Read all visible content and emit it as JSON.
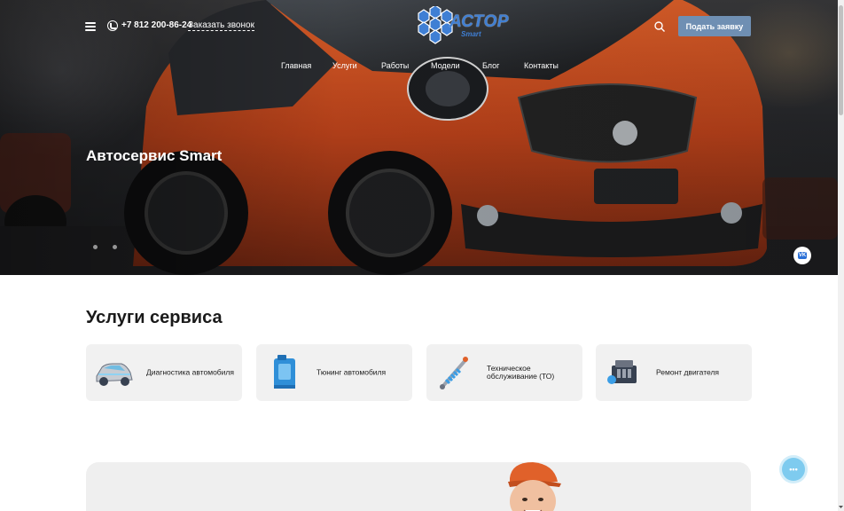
{
  "header": {
    "phone_number": "+7 812 200-86-24",
    "callback_label": "Заказать звонок",
    "logo_text": "АСТОР",
    "logo_sub": "Smart",
    "cta_label": "Подать заявку"
  },
  "nav": {
    "items": [
      {
        "label": "Главная"
      },
      {
        "label": "Услуги"
      },
      {
        "label": "Работы"
      },
      {
        "label": "Модели"
      },
      {
        "label": "Блог"
      },
      {
        "label": "Контакты"
      }
    ]
  },
  "hero": {
    "title": "Автосервис Smart",
    "slides_count": 2,
    "active_slide": 1
  },
  "services": {
    "title": "Услуги сервиса",
    "items": [
      {
        "label": "Диагностика автомобиля",
        "icon": "car-diagnostics-icon"
      },
      {
        "label": "Тюнинг автомобиля",
        "icon": "canister-icon"
      },
      {
        "label": "Техническое обслуживание (ТО)",
        "icon": "shock-absorber-icon"
      },
      {
        "label": "Ремонт двигателя",
        "icon": "engine-icon"
      }
    ]
  },
  "colors": {
    "accent": "#6f8fb3",
    "logo_blue": "#3f7fd4",
    "car_orange": "#c0461a",
    "chat_button": "#7ecbef",
    "card_bg": "#f1f1f1"
  },
  "widgets": {
    "vk_label": "VK",
    "chat_label": "•••"
  }
}
